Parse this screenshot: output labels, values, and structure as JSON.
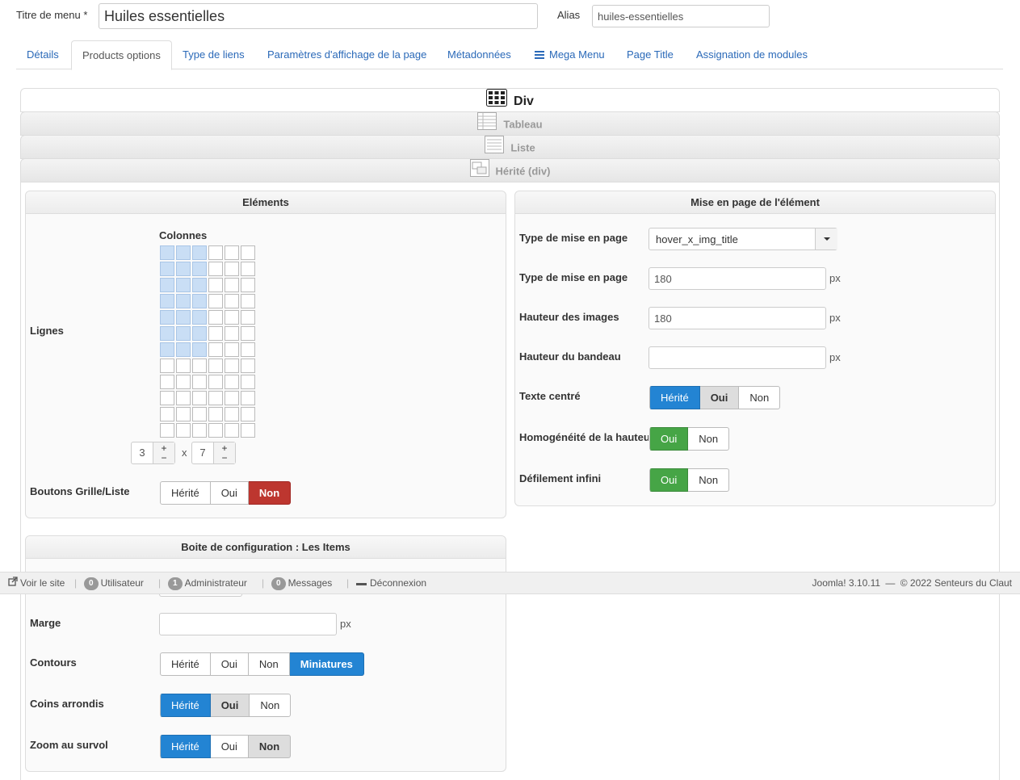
{
  "header": {
    "title_label": "Titre de menu *",
    "title_value": "Huiles essentielles",
    "alias_label": "Alias",
    "alias_value": "huiles-essentielles"
  },
  "tabs": [
    {
      "label": "Détails"
    },
    {
      "label": "Products options",
      "active": true
    },
    {
      "label": "Type de liens"
    },
    {
      "label": "Paramètres d'affichage de la page"
    },
    {
      "label": "Métadonnées"
    },
    {
      "label": "Mega Menu",
      "icon": "hamburger-icon"
    },
    {
      "label": "Page Title"
    },
    {
      "label": "Assignation de modules"
    }
  ],
  "layout_types": [
    {
      "label": "Div",
      "icon": "grid-icon",
      "active": true
    },
    {
      "label": "Tableau",
      "icon": "table-icon"
    },
    {
      "label": "Liste",
      "icon": "list-icon"
    },
    {
      "label": "Hérité (div)",
      "icon": "inherit-icon"
    }
  ],
  "elements_panel": {
    "title": "Eléments",
    "columns_label": "Colonnes",
    "rows_label": "Lignes",
    "grid": {
      "total_cols": 6,
      "total_rows": 12,
      "selected_cols": 3,
      "selected_rows": 7
    },
    "cols_value": "3",
    "rows_value": "7",
    "times": "x",
    "plus": "+",
    "minus": "−",
    "grid_list_label": "Boutons Grille/Liste",
    "grid_list_buttons": [
      "Hérité",
      "Oui",
      "Non"
    ],
    "grid_list_active": "Non"
  },
  "layout_panel": {
    "title": "Mise en page de l'élément",
    "layout_type_label": "Type de mise en page",
    "layout_type_value": "hover_x_img_title",
    "width_label": "Type de mise en page",
    "width_value": "180",
    "img_height_label": "Hauteur des images",
    "img_height_value": "180",
    "banner_height_label": "Hauteur du bandeau",
    "banner_height_value": "",
    "unit": "px",
    "centered_label": "Texte centré",
    "centered_buttons": [
      "Hérité",
      "Oui",
      "Non"
    ],
    "homog_label": "Homogénéité de la hauteur",
    "homog_buttons": [
      "Oui",
      "Non"
    ],
    "infinite_label": "Défilement infini",
    "infinite_buttons": [
      "Oui",
      "Non"
    ]
  },
  "items_panel": {
    "title": "Boite de configuration : Les Items",
    "margin_label": "Marge",
    "margin_value": "",
    "unit": "px",
    "borders_label": "Contours",
    "borders_buttons": [
      "Hérité",
      "Oui",
      "Non",
      "Miniatures"
    ],
    "rounded_label": "Coins arrondis",
    "rounded_buttons": [
      "Hérité",
      "Oui",
      "Non"
    ],
    "zoom_label": "Zoom au survol",
    "zoom_buttons": [
      "Hérité",
      "Oui",
      "Non"
    ]
  },
  "statusbar": {
    "view_site": "Voir le site",
    "users_count": "0",
    "users_label": "Utilisateur",
    "admins_count": "1",
    "admins_label": "Administrateur",
    "messages_count": "0",
    "messages_label": "Messages",
    "logout_label": "Déconnexion",
    "version": "Joomla! 3.10.11",
    "dash": "—",
    "copyright": "© 2022 Senteurs du Claut"
  },
  "colors": {
    "accent_blue": "#2384d3",
    "danger_red": "#bd362f",
    "success_green": "#46a546",
    "link": "#2a69b8"
  }
}
